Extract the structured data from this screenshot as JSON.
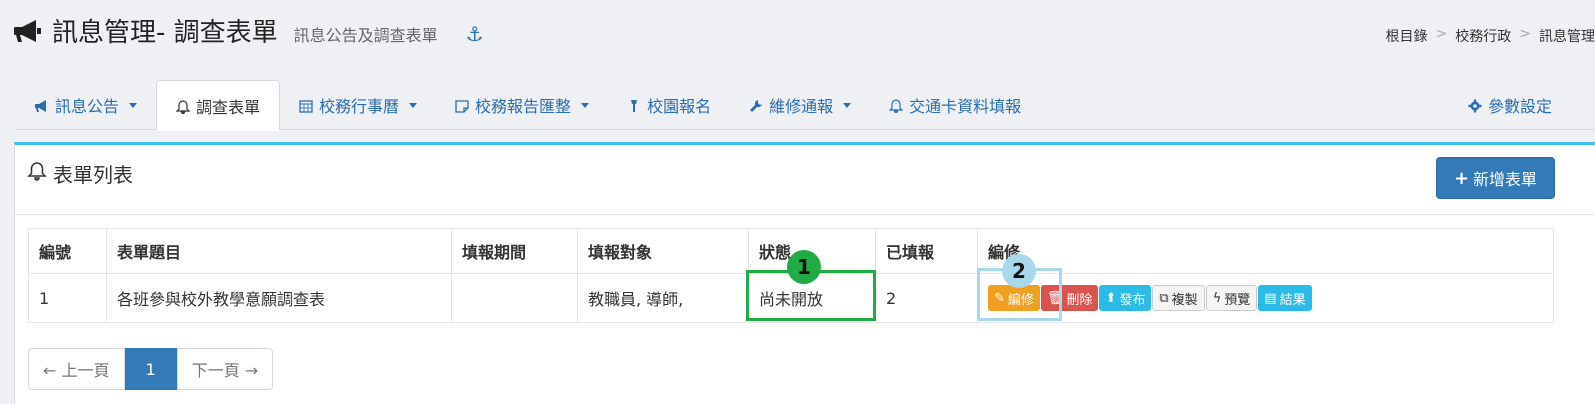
{
  "header": {
    "title": "訊息管理- 調查表單",
    "subtitle": "訊息公告及調查表單",
    "anchor_icon": "anchor-icon"
  },
  "breadcrumb": [
    "根目錄",
    "校務行政",
    "訊息管理"
  ],
  "breadcrumb_sep": ">",
  "tabs": [
    {
      "label": "訊息公告",
      "icon": "bullhorn-icon",
      "dropdown": true
    },
    {
      "label": "調查表單",
      "icon": "bell-icon",
      "dropdown": false,
      "active": true
    },
    {
      "label": "校務行事曆",
      "icon": "calendar-icon",
      "dropdown": true
    },
    {
      "label": "校務報告匯整",
      "icon": "sticky-note-icon",
      "dropdown": true
    },
    {
      "label": "校園報名",
      "icon": "flag-icon",
      "dropdown": false
    },
    {
      "label": "維修通報",
      "icon": "wrench-icon",
      "dropdown": true
    },
    {
      "label": "交通卡資料填報",
      "icon": "bell-icon",
      "dropdown": false
    },
    {
      "label": "參數設定",
      "icon": "gear-icon",
      "dropdown": false
    }
  ],
  "panel": {
    "title": "表單列表",
    "new_button": "新增表單"
  },
  "table": {
    "headers": [
      "編號",
      "表單題目",
      "填報期間",
      "填報對象",
      "狀態",
      "已填報",
      "編修"
    ],
    "rows": [
      {
        "id": "1",
        "title": "各班參與校外教學意願調查表",
        "period": "",
        "target": "教職員, 導師,",
        "status": "尚未開放",
        "filled": "2"
      }
    ],
    "actions": {
      "edit": "編修",
      "delete": "刪除",
      "publish": "發布",
      "copy": "複製",
      "preview": "預覽",
      "result": "結果"
    }
  },
  "pager": {
    "prev": "← 上一頁",
    "current": "1",
    "next": "下一頁 →"
  },
  "annotations": {
    "badge1": "1",
    "badge2": "2"
  },
  "colors": {
    "accent": "#337ab7",
    "panel_top": "#3cc0e6",
    "annotation1": "#22aa44",
    "annotation2": "#a8d8ea"
  }
}
